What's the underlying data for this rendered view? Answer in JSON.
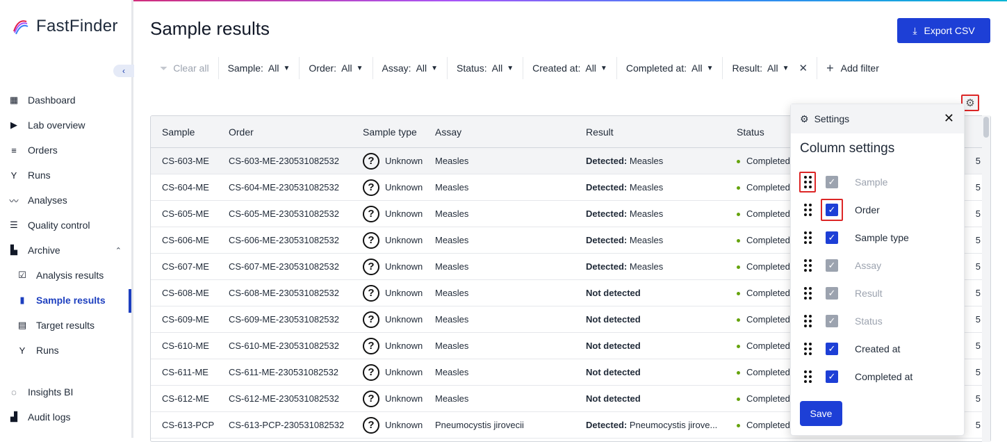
{
  "app": {
    "name": "FastFinder"
  },
  "sidebar": {
    "items": [
      {
        "label": "Dashboard",
        "icon": "dashboard-icon"
      },
      {
        "label": "Lab overview",
        "icon": "play-icon"
      },
      {
        "label": "Orders",
        "icon": "orders-icon"
      },
      {
        "label": "Runs",
        "icon": "fork-icon"
      },
      {
        "label": "Analyses",
        "icon": "trend-icon"
      },
      {
        "label": "Quality control",
        "icon": "list-icon"
      },
      {
        "label": "Archive",
        "icon": "chart-icon"
      },
      {
        "label": "Analysis results",
        "icon": "clipboard-check-icon"
      },
      {
        "label": "Sample results",
        "icon": "bars-icon"
      },
      {
        "label": "Target results",
        "icon": "clipboard-list-icon"
      },
      {
        "label": "Runs",
        "icon": "fork-icon"
      }
    ],
    "bottom": [
      {
        "label": "Insights BI",
        "icon": "ring-icon"
      },
      {
        "label": "Audit logs",
        "icon": "bar-chart-icon"
      }
    ]
  },
  "page": {
    "title": "Sample results",
    "export_label": "Export CSV"
  },
  "filters": {
    "clear_label": "Clear all",
    "items": [
      {
        "label": "Sample:",
        "value": "All"
      },
      {
        "label": "Order:",
        "value": "All"
      },
      {
        "label": "Assay:",
        "value": "All"
      },
      {
        "label": "Status:",
        "value": "All"
      },
      {
        "label": "Created at:",
        "value": "All"
      },
      {
        "label": "Completed at:",
        "value": "All"
      },
      {
        "label": "Result:",
        "value": "All"
      }
    ],
    "add_label": "Add filter"
  },
  "table": {
    "headers": [
      "Sample",
      "Order",
      "Sample type",
      "Assay",
      "Result",
      "Status"
    ],
    "rows": [
      {
        "sample": "CS-603-ME",
        "order": "CS-603-ME-230531082532",
        "type": "Unknown",
        "assay": "Measles",
        "result_bold": "Detected:",
        "result_rest": " Measles",
        "status": "Completed",
        "extra": "5"
      },
      {
        "sample": "CS-604-ME",
        "order": "CS-604-ME-230531082532",
        "type": "Unknown",
        "assay": "Measles",
        "result_bold": "Detected:",
        "result_rest": " Measles",
        "status": "Completed",
        "extra": "5"
      },
      {
        "sample": "CS-605-ME",
        "order": "CS-605-ME-230531082532",
        "type": "Unknown",
        "assay": "Measles",
        "result_bold": "Detected:",
        "result_rest": " Measles",
        "status": "Completed",
        "extra": "5"
      },
      {
        "sample": "CS-606-ME",
        "order": "CS-606-ME-230531082532",
        "type": "Unknown",
        "assay": "Measles",
        "result_bold": "Detected:",
        "result_rest": " Measles",
        "status": "Completed",
        "extra": "5"
      },
      {
        "sample": "CS-607-ME",
        "order": "CS-607-ME-230531082532",
        "type": "Unknown",
        "assay": "Measles",
        "result_bold": "Detected:",
        "result_rest": " Measles",
        "status": "Completed",
        "extra": "5"
      },
      {
        "sample": "CS-608-ME",
        "order": "CS-608-ME-230531082532",
        "type": "Unknown",
        "assay": "Measles",
        "result_bold": "Not detected",
        "result_rest": "",
        "status": "Completed",
        "extra": "5"
      },
      {
        "sample": "CS-609-ME",
        "order": "CS-609-ME-230531082532",
        "type": "Unknown",
        "assay": "Measles",
        "result_bold": "Not detected",
        "result_rest": "",
        "status": "Completed",
        "extra": "5"
      },
      {
        "sample": "CS-610-ME",
        "order": "CS-610-ME-230531082532",
        "type": "Unknown",
        "assay": "Measles",
        "result_bold": "Not detected",
        "result_rest": "",
        "status": "Completed",
        "extra": "5"
      },
      {
        "sample": "CS-611-ME",
        "order": "CS-611-ME-230531082532",
        "type": "Unknown",
        "assay": "Measles",
        "result_bold": "Not detected",
        "result_rest": "",
        "status": "Completed",
        "extra": "5"
      },
      {
        "sample": "CS-612-ME",
        "order": "CS-612-ME-230531082532",
        "type": "Unknown",
        "assay": "Measles",
        "result_bold": "Not detected",
        "result_rest": "",
        "status": "Completed",
        "extra": "5"
      },
      {
        "sample": "CS-613-PCP",
        "order": "CS-613-PCP-230531082532",
        "type": "Unknown",
        "assay": "Pneumocystis jirovecii",
        "result_bold": "Detected:",
        "result_rest": " Pneumocystis jirove...",
        "status": "Completed",
        "extra": "5"
      }
    ]
  },
  "settings": {
    "header": "Settings",
    "title": "Column settings",
    "columns": [
      {
        "label": "Sample",
        "checked": true,
        "disabled": true
      },
      {
        "label": "Order",
        "checked": true,
        "disabled": false
      },
      {
        "label": "Sample type",
        "checked": true,
        "disabled": false
      },
      {
        "label": "Assay",
        "checked": true,
        "disabled": true
      },
      {
        "label": "Result",
        "checked": true,
        "disabled": true
      },
      {
        "label": "Status",
        "checked": true,
        "disabled": true
      },
      {
        "label": "Created at",
        "checked": true,
        "disabled": false
      },
      {
        "label": "Completed at",
        "checked": true,
        "disabled": false
      }
    ],
    "save_label": "Save"
  },
  "colors": {
    "primary": "#1d3fd6",
    "status_ok": "#65a30d",
    "highlight": "#dc2626"
  }
}
